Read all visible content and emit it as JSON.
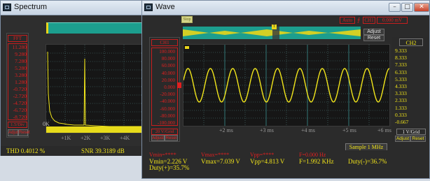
{
  "spectrum": {
    "title": "Spectrum",
    "scale_title": "FFT",
    "scale_values": [
      "11.280",
      "9.280",
      "7.280",
      "5.280",
      "3.280",
      "1.280",
      "-0.720",
      "-2.720",
      "-4.720",
      "-6.720",
      "-8.720"
    ],
    "scale_unit": "1.5/Div",
    "adjust_label": "Adjust",
    "reset_label": "Reset",
    "x_ticks": [
      "0K",
      "+1K",
      "+2K",
      "+3K",
      "+4K"
    ],
    "thd": "THD 0.4012 %",
    "snr": "SNR 39.3189 dB"
  },
  "wave": {
    "title": "Wave",
    "hold_label": "Stop",
    "trigger_label": "Auto",
    "trigger_channel": "CH1",
    "trigger_level": "0.000 mV",
    "adjust_label": "Adjust",
    "reset_label": "Reset",
    "ch1": {
      "name": "CH1",
      "values": [
        "100.000",
        "80.000",
        "60.000",
        "40.000",
        "20.000",
        "0.000",
        "-20.000",
        "-40.000",
        "-60.000",
        "-80.000",
        "-100.000"
      ],
      "unit": "20 V/Grid",
      "adjust_label": "Adjust",
      "reset_label": "Reset"
    },
    "ch2": {
      "name": "CH2",
      "values": [
        "9.333",
        "8.333",
        "7.333",
        "6.333",
        "5.333",
        "4.333",
        "3.333",
        "2.333",
        "1.333",
        "0.333",
        "-0.667"
      ],
      "unit": "1 V/Grid",
      "adjust_label": "Adjust",
      "reset_label": "Reset"
    },
    "x_ticks": [
      "+2 ms",
      "+3 ms",
      "+4 ms",
      "+5 ms",
      "+6 ms"
    ],
    "sample_rate": "Sample 1 MHz",
    "stats_red": [
      "Vmin=****",
      "Vmax=****",
      "Vpp=****",
      "F=0.000 Hz"
    ],
    "stats_yellow": [
      "Vmin=2.226 V",
      "Vmax=7.039 V",
      "Vpp=4.813 V",
      "F=1.992 KHz"
    ],
    "duty_plus": "Duty(+)=35.7%",
    "duty_minus": "Duty(-)=36.7%"
  },
  "colors": {
    "trace": "#f2e61b",
    "ch1_accent": "#e02020",
    "grid": "#4f7d7d",
    "overview_bar": "#1c9e8e"
  },
  "icons": [
    "spectrum-window-icon",
    "wave-window-icon",
    "minimize-icon",
    "maximize-icon",
    "close-icon",
    "trigger-marker-icon"
  ]
}
